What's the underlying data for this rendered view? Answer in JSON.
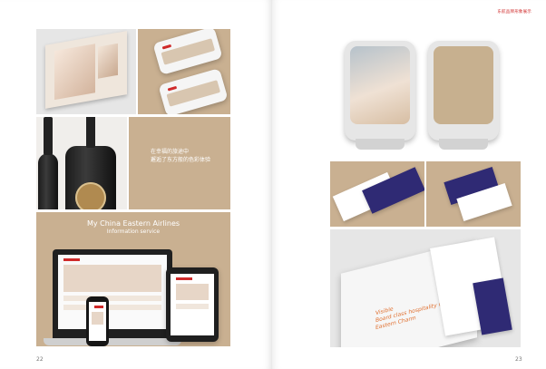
{
  "left_page": {
    "page_number": "22",
    "wine_headline": "在幸福的旅途中\n邂逅了东方般的色彩体验",
    "web_title": "My China Eastern Airlines",
    "web_subtitle": "Information service"
  },
  "right_page": {
    "page_number": "23",
    "header": "东航品牌形象展示",
    "folder_text": "Visible\nBoard class hospitality with\nEastern Charm"
  },
  "colors": {
    "tan": "#c9b091",
    "brand_red": "#cf2a2a",
    "navy": "#2f2a74"
  }
}
